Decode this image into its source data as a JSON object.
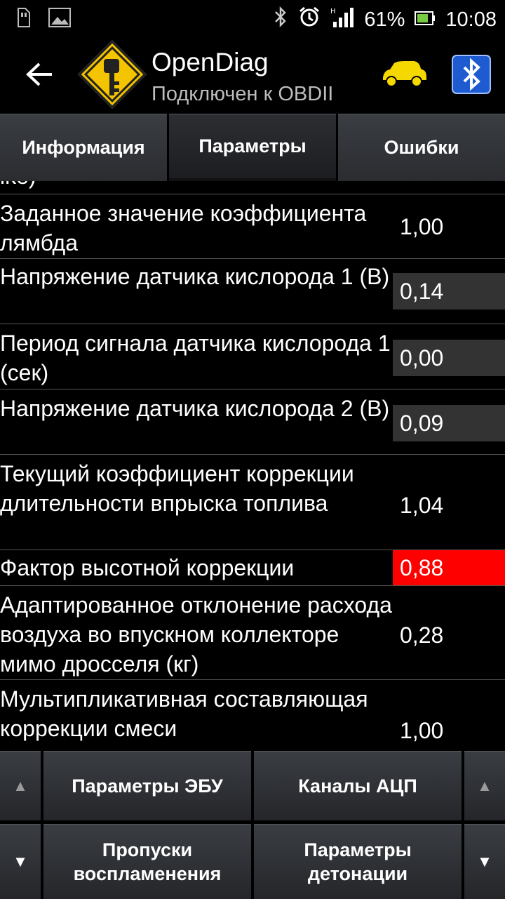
{
  "status": {
    "battery": "61%",
    "time": "10:08"
  },
  "header": {
    "title": "OpenDiag",
    "subtitle": "Подключен к OBDII"
  },
  "tabs": [
    {
      "label": "Информация"
    },
    {
      "label": "Параметры"
    },
    {
      "label": "Ошибки"
    }
  ],
  "list": {
    "cut_text": "ike)",
    "rows": [
      {
        "label": "Заданное значение коэффициента лямбда",
        "value": "1,00"
      },
      {
        "label": "Напряжение датчика кислорода 1 (В)",
        "value": "0,14"
      },
      {
        "label": "Период сигнала датчика кислорода 1 (сек)",
        "value": "0,00"
      },
      {
        "label": "Напряжение датчика кислорода 2 (В)",
        "value": "0,09"
      },
      {
        "label": "Текущий коэффициент коррекции длительности впрыска топлива",
        "value": "1,04"
      },
      {
        "label": "Фактор высотной коррекции",
        "value": "0,88"
      },
      {
        "label": "Адаптированное отклонение расхода воздуха во впускном коллекторе мимо дросселя (кг)",
        "value": "0,28"
      },
      {
        "label": "Мультипликативная составляющая коррекции смеси",
        "value": "1,00"
      }
    ]
  },
  "bottom": {
    "btn_ecu": "Параметры ЭБУ",
    "btn_adc": "Каналы АЦП",
    "btn_misfire": "Пропуски воспламенения",
    "btn_knock": "Параметры детонации",
    "up_glyph": "▲",
    "down_glyph": "▼"
  },
  "colors": {
    "alert": "#ff0000",
    "value_box": "#333333",
    "logo_yellow": "#f5c400",
    "car_yellow": "#f5d800",
    "bt_blue": "#1e5bd0"
  }
}
